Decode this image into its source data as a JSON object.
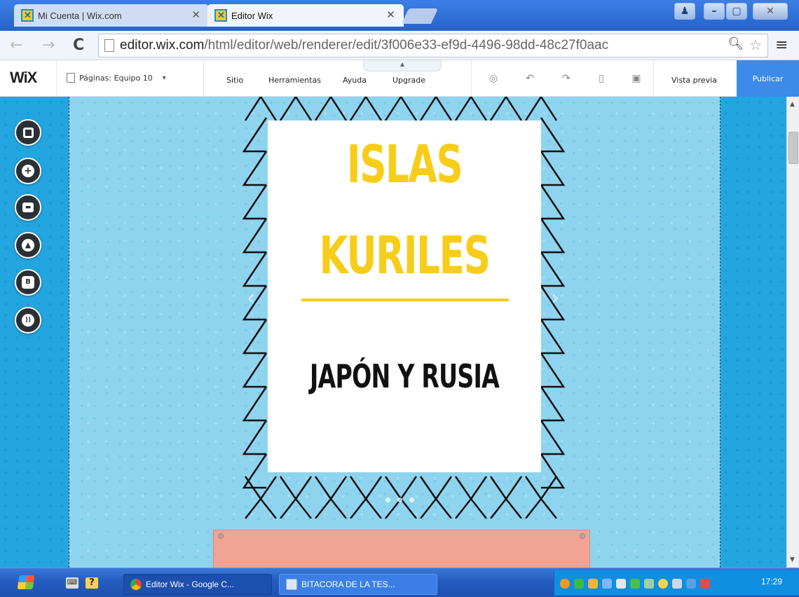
{
  "browser": {
    "tabs": [
      {
        "label": "Mi Cuenta | Wix.com"
      },
      {
        "label": "Editor Wix"
      }
    ],
    "url_host": "editor.wix.com",
    "url_path": "/html/editor/web/renderer/edit/3f006e33-ef9d-4496-98dd-48c27f0aac"
  },
  "wix": {
    "logo": "WiX",
    "pages_label": "Páginas: Equipo 10",
    "menu": {
      "sitio": "Sitio",
      "herramientas": "Herramientas",
      "ayuda": "Ayuda",
      "upgrade": "Upgrade"
    },
    "preview": "Vista previa",
    "publish": "Publicar"
  },
  "slide": {
    "title_line1": "ISLAS",
    "title_line2": "KURILES",
    "subtitle": "JAPÓN Y RUSIA"
  },
  "taskbar": {
    "items": [
      {
        "label": "Editor Wix - Google C..."
      },
      {
        "label": "BITACORA DE LA TES..."
      }
    ],
    "clock": "17:29"
  },
  "colors": {
    "title_yellow": "#f8cd1a",
    "canvas_blue": "#8fd4ef",
    "strip_blue": "#23a5e0",
    "publish_blue": "#3d8ae8",
    "pink_box": "#f2a494"
  }
}
